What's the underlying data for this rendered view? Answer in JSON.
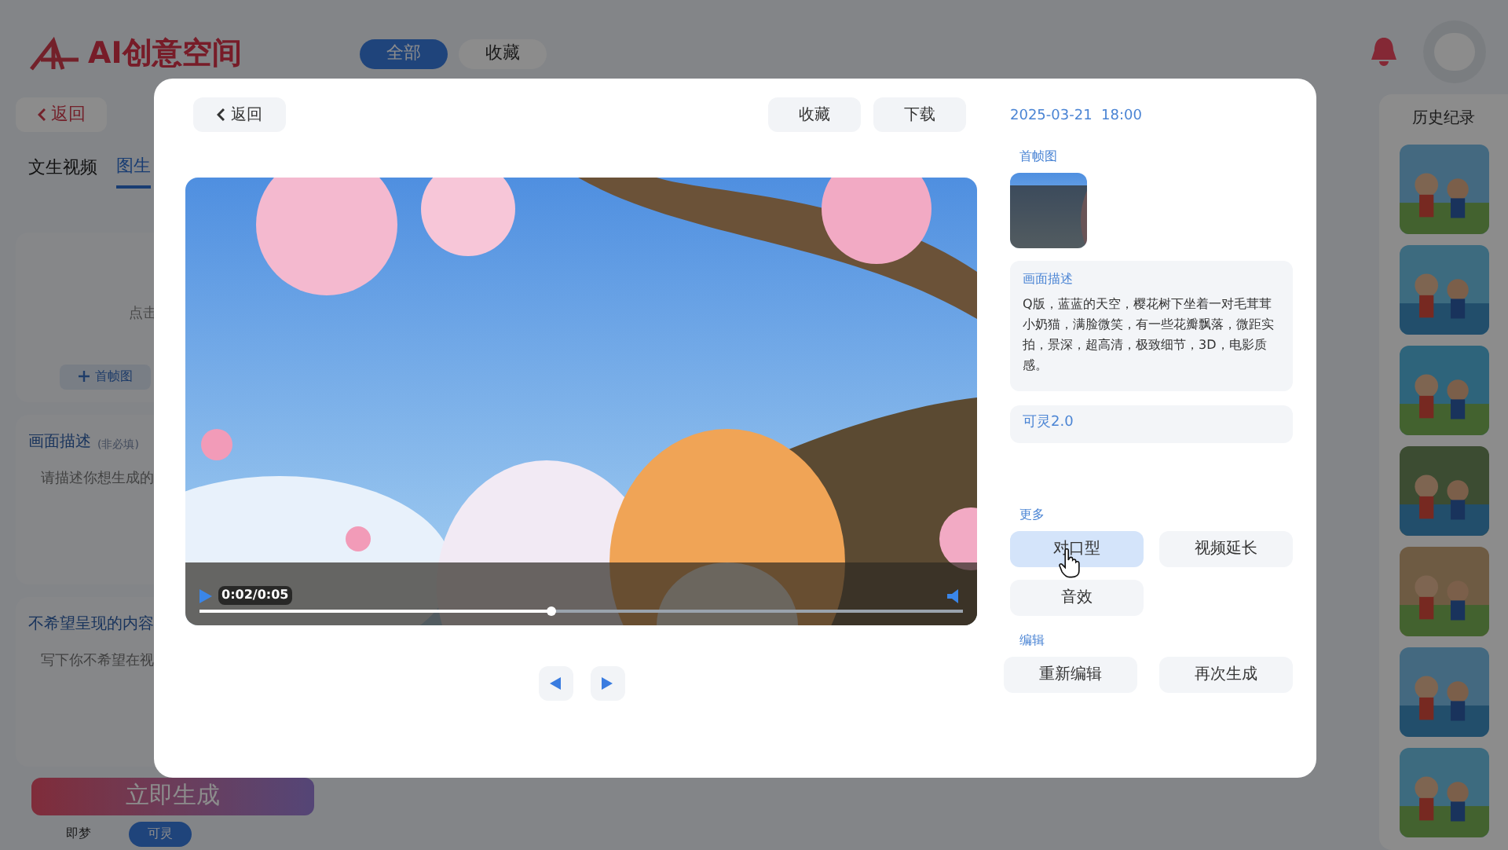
{
  "header": {
    "logo": "AI创意空间",
    "tabs": [
      {
        "label": "全部",
        "selected": true
      },
      {
        "label": "收藏",
        "selected": false
      }
    ]
  },
  "left_panel": {
    "back": "返回",
    "mode_tabs": [
      {
        "label": "文生视频",
        "selected": false
      },
      {
        "label": "图生",
        "selected": true
      }
    ],
    "upload_hint": "点击",
    "upload_button": "首帧图",
    "description": {
      "label": "画面描述",
      "note": "(非必填)",
      "placeholder": "请描述你想生成的"
    },
    "negative": {
      "label": "不希望呈现的内容",
      "placeholder": "写下你不希望在视"
    },
    "generate": "立即生成",
    "models": [
      {
        "label": "即梦",
        "selected": false
      },
      {
        "label": "可灵",
        "selected": true
      }
    ]
  },
  "history": {
    "title": "历史纪录"
  },
  "modal": {
    "back": "返回",
    "actions": [
      "收藏",
      "下载"
    ],
    "video": {
      "time": "0:02/0:05",
      "level": 0.46
    },
    "details": {
      "date": "2025-03-21  18:00",
      "first_frame_label": "首帧图",
      "description_label": "画面描述",
      "description": "Q版，蓝蓝的天空，樱花树下坐着一对毛茸茸小奶猫，满脸微笑，有一些花瓣飘落，微距实拍，景深，超高清，极致细节，3D，电影质感。",
      "model": "可灵2.0",
      "more_label": "更多",
      "more": [
        {
          "label": "对口型",
          "selected": true
        },
        {
          "label": "视频延长",
          "selected": false
        },
        {
          "label": "音效",
          "selected": false
        }
      ],
      "edit_label": "编辑",
      "edit": [
        "重新编辑",
        "再次生成"
      ]
    }
  }
}
